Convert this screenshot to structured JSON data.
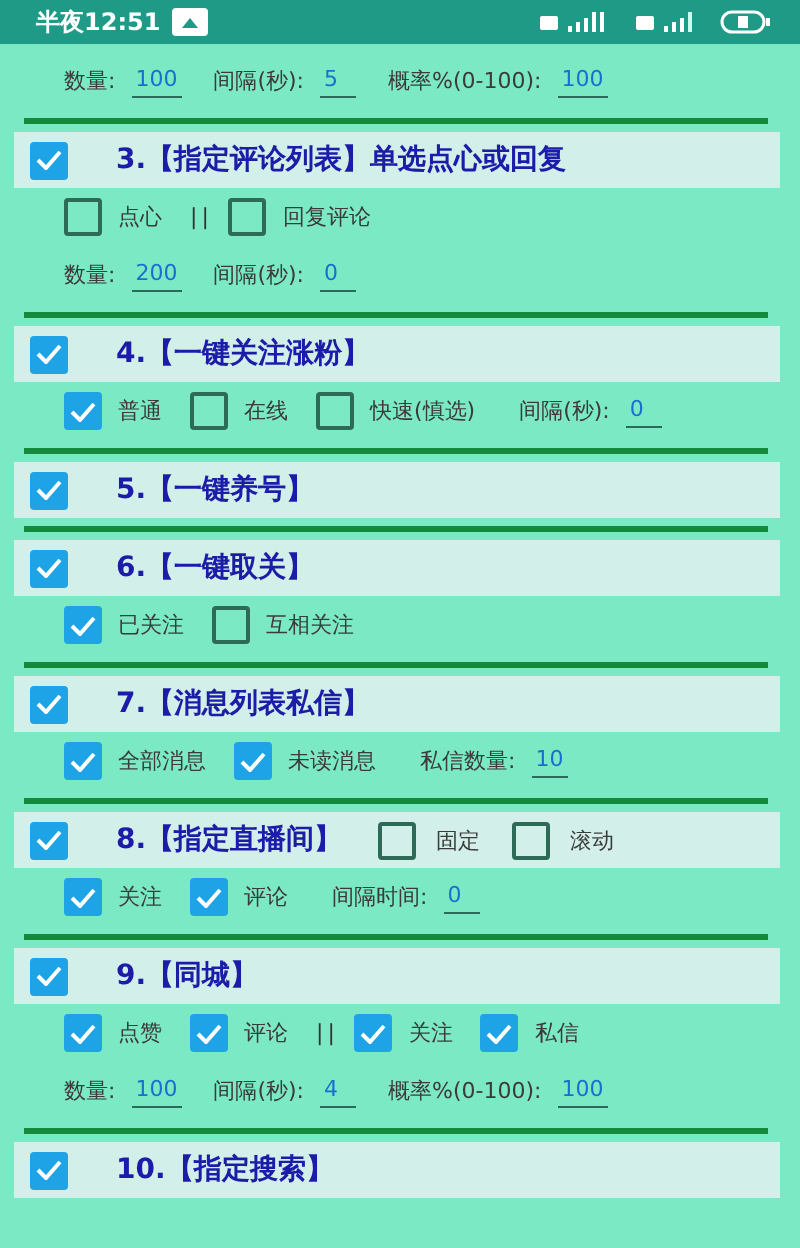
{
  "status_bar": {
    "time": "半夜12:51"
  },
  "sections": [
    {
      "fields": [
        {
          "label": "数量:",
          "value": "100"
        },
        {
          "label": "间隔(秒):",
          "value": "5"
        },
        {
          "label": "概率%(0-100):",
          "value": "100"
        }
      ]
    },
    {
      "header": {
        "checked": true,
        "title": "3.【指定评论列表】单选点心或回复"
      },
      "options": [
        {
          "kind": "checkbox",
          "label": "点心",
          "checked": false
        },
        {
          "kind": "separator",
          "text": "||"
        },
        {
          "kind": "checkbox",
          "label": "回复评论",
          "checked": false
        }
      ],
      "fields": [
        {
          "label": "数量:",
          "value": "200"
        },
        {
          "label": "间隔(秒):",
          "value": "0"
        }
      ]
    },
    {
      "header": {
        "checked": true,
        "title": "4.【一键关注涨粉】"
      },
      "options": [
        {
          "kind": "checkbox",
          "label": "普通",
          "checked": true
        },
        {
          "kind": "checkbox",
          "label": "在线",
          "checked": false
        },
        {
          "kind": "checkbox",
          "label": "快速(慎选)",
          "checked": false
        },
        {
          "kind": "field",
          "label": "间隔(秒):",
          "value": "0"
        }
      ]
    },
    {
      "header": {
        "checked": true,
        "title": "5.【一键养号】"
      }
    },
    {
      "header": {
        "checked": true,
        "title": "6.【一键取关】"
      },
      "options": [
        {
          "kind": "checkbox",
          "label": "已关注",
          "checked": true
        },
        {
          "kind": "checkbox",
          "label": "互相关注",
          "checked": false
        }
      ]
    },
    {
      "header": {
        "checked": true,
        "title": "7.【消息列表私信】"
      },
      "options": [
        {
          "kind": "checkbox",
          "label": "全部消息",
          "checked": true
        },
        {
          "kind": "checkbox",
          "label": "未读消息",
          "checked": true
        },
        {
          "kind": "field",
          "label": "私信数量:",
          "value": "10"
        }
      ]
    },
    {
      "header": {
        "checked": true,
        "title": "8.【指定直播间】",
        "options": [
          {
            "kind": "checkbox",
            "label": "固定",
            "checked": false
          },
          {
            "kind": "checkbox",
            "label": "滚动",
            "checked": false
          }
        ]
      },
      "options": [
        {
          "kind": "checkbox",
          "label": "关注",
          "checked": true
        },
        {
          "kind": "checkbox",
          "label": "评论",
          "checked": true
        },
        {
          "kind": "field",
          "label": "间隔时间:",
          "value": "0"
        }
      ]
    },
    {
      "header": {
        "checked": true,
        "title": "9.【同城】"
      },
      "options": [
        {
          "kind": "checkbox",
          "label": "点赞",
          "checked": true
        },
        {
          "kind": "checkbox",
          "label": "评论",
          "checked": true
        },
        {
          "kind": "separator",
          "text": "||"
        },
        {
          "kind": "checkbox",
          "label": "关注",
          "checked": true
        },
        {
          "kind": "checkbox",
          "label": "私信",
          "checked": true
        }
      ],
      "fields": [
        {
          "label": "数量:",
          "value": "100"
        },
        {
          "label": "间隔(秒):",
          "value": "4"
        },
        {
          "label": "概率%(0-100):",
          "value": "100"
        }
      ]
    },
    {
      "header": {
        "checked": true,
        "title": "10.【指定搜索】"
      }
    }
  ]
}
